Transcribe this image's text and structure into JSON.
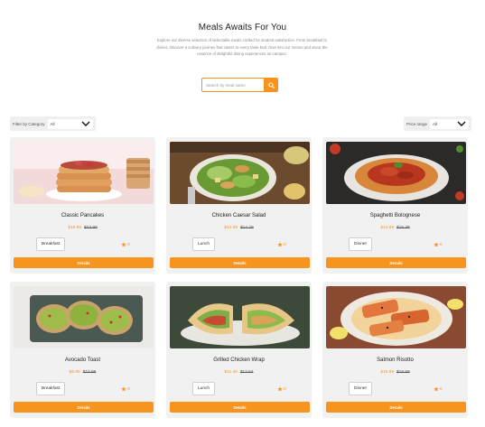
{
  "header": {
    "title": "Meals Awaits For You",
    "subtitle": "Explore our diverse selection of delectable meals crafted for student satisfaction. From breakfast to dinner, discover a culinary journey that caters to every taste bud. Dive into our menus and savor the essence of delightful dining experiences on campus."
  },
  "search": {
    "placeholder": "Search by meal name",
    "icon": "search-icon"
  },
  "filters": {
    "category_label": "Filter by Category",
    "category_value": "All",
    "price_label": "Price range",
    "price_value": "All"
  },
  "accent_color": "#f7941d",
  "meals": [
    {
      "name": "Classic Pancakes",
      "price": "$19.99",
      "old_price": "$23.99",
      "category": "Breakfast",
      "rating": "0",
      "button": "Details"
    },
    {
      "name": "Chicken Caesar Salad",
      "price": "$12.99",
      "old_price": "$14.29",
      "category": "Lunch",
      "rating": "0",
      "button": "Details"
    },
    {
      "name": "Spaghetti Bolognese",
      "price": "$14.99",
      "old_price": "$16.49",
      "category": "Dinner",
      "rating": "0",
      "button": "Details"
    },
    {
      "name": "Avocado Toast",
      "price": "$8.99",
      "old_price": "$10.99",
      "category": "Breakfast",
      "rating": "0",
      "button": "Details"
    },
    {
      "name": "Grilled Chicken Wrap",
      "price": "$11.49",
      "old_price": "$12.64",
      "category": "Lunch",
      "rating": "0",
      "button": "Details"
    },
    {
      "name": "Salmon Risotto",
      "price": "$16.99",
      "old_price": "$18.69",
      "category": "Dinner",
      "rating": "0",
      "button": "Details"
    }
  ]
}
